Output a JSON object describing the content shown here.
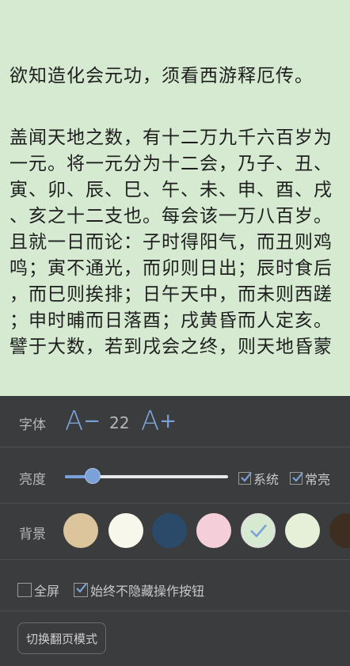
{
  "reader": {
    "para1": "欲知造化会元功，须看西游释厄传。",
    "para2_lines": [
      "盖闻天地之数，有十二万九千六百岁为",
      "一元。将一元分为十二会，乃子、丑、",
      "寅、卯、辰、巳、午、未、申、酉、戌",
      "、亥之十二支也。每会该一万八百岁。",
      "且就一日而论：子时得阳气，而丑则鸡",
      "鸣；寅不通光，而卯则日出；辰时食后",
      "，而巳则挨排；日午天中，而未则西蹉",
      "；申时晡而日落酉；戌黄昏而人定亥。",
      "譬于大数，若到戌会之终，则天地昏蒙"
    ]
  },
  "settings": {
    "font": {
      "label": "字体",
      "decrease_glyph": "A",
      "decrease_mark": "−",
      "size": "22",
      "increase_glyph": "A",
      "increase_mark": "+"
    },
    "brightness": {
      "label": "亮度",
      "level_fraction": 0.17,
      "system_label": "系统",
      "system_checked": true,
      "keep_on_label": "常亮",
      "keep_on_checked": true
    },
    "background": {
      "label": "背景",
      "swatches": [
        {
          "color": "#dcc59c",
          "selected": false
        },
        {
          "color": "#f8f7ec",
          "selected": false
        },
        {
          "color": "#2b4a6a",
          "selected": false
        },
        {
          "color": "#f4cfd9",
          "selected": false
        },
        {
          "color": "#d5ead1",
          "selected": true
        },
        {
          "color": "#e6f0d8",
          "selected": false
        },
        {
          "color": "#3e2e22",
          "selected": false
        }
      ]
    },
    "options": {
      "fullscreen_label": "全屏",
      "fullscreen_checked": false,
      "always_show_label": "始终不隐藏操作按钮",
      "always_show_checked": true
    },
    "switch_page_mode_label": "切换翻页模式"
  },
  "colors": {
    "accent": "#7aa2d8",
    "panel_bg": "#3b3c3e",
    "reader_bg": "#d5ead1"
  }
}
